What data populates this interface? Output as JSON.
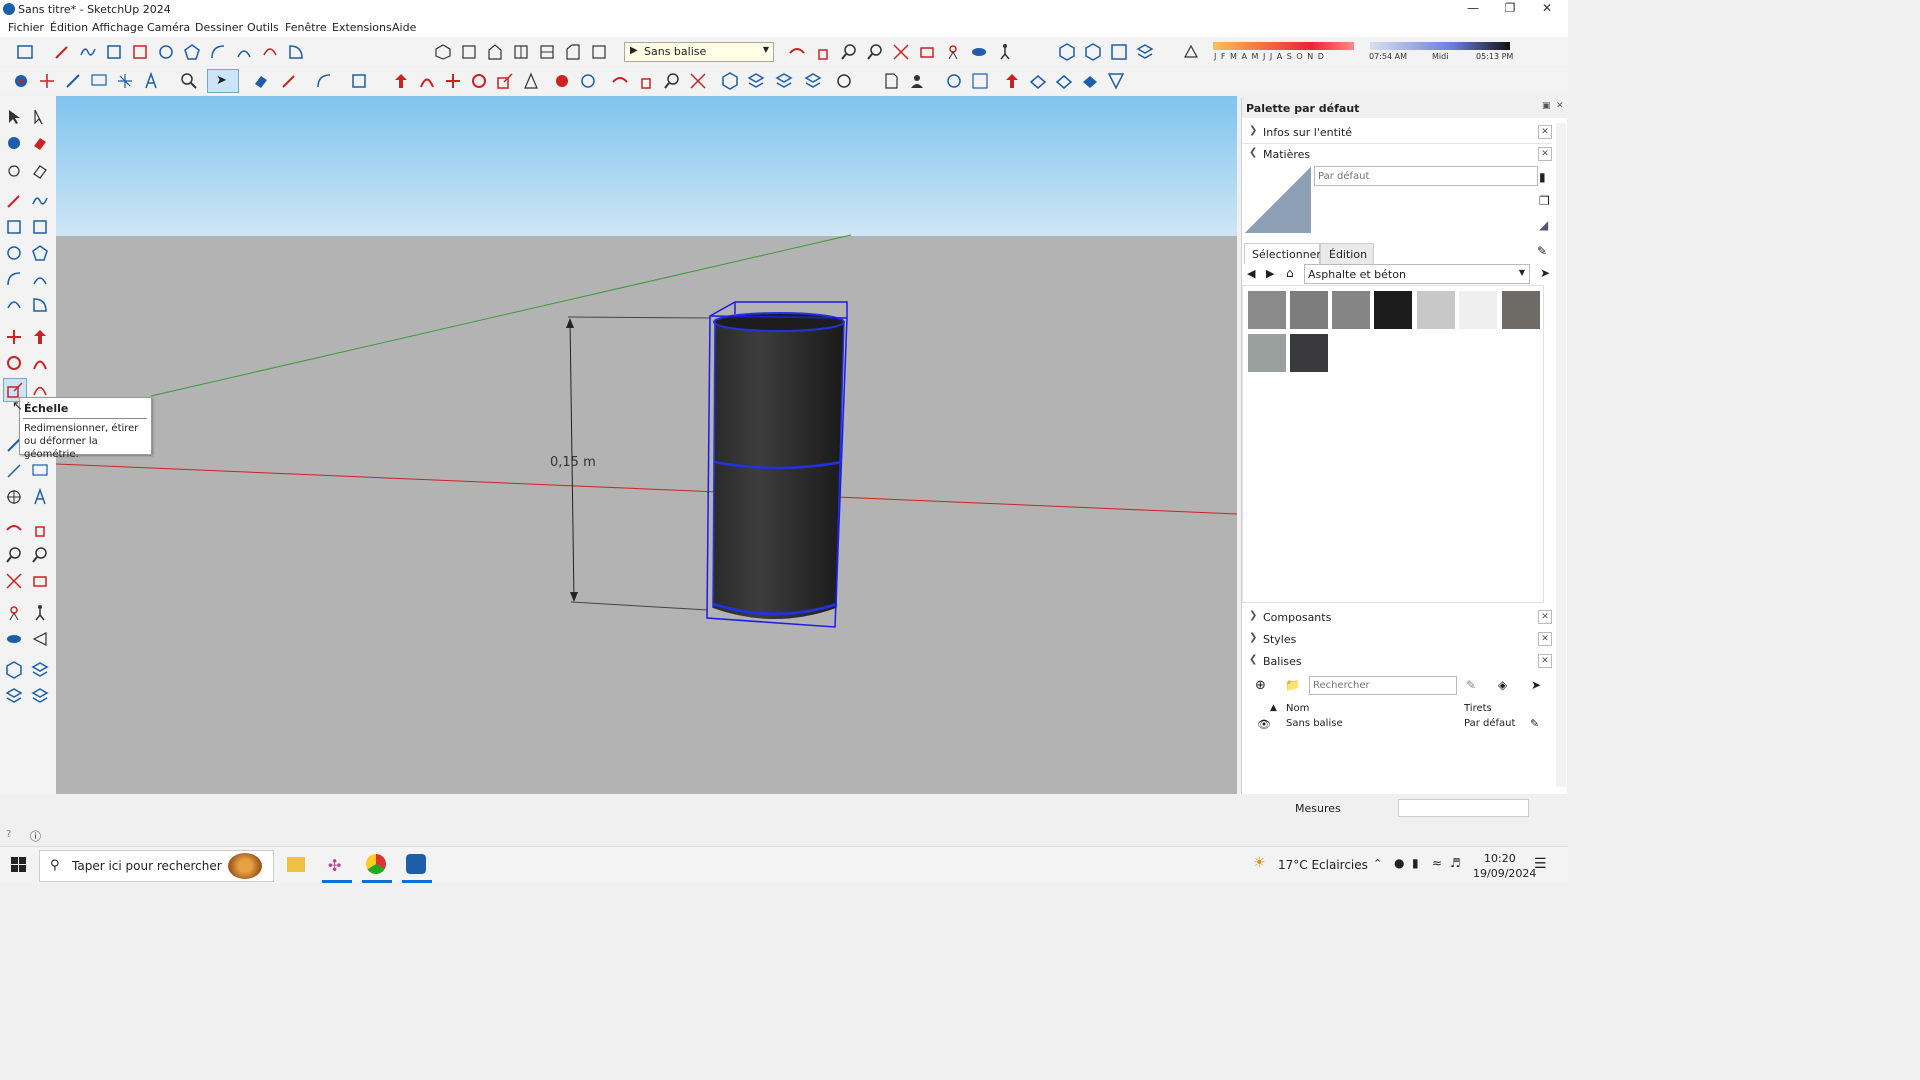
{
  "window": {
    "title": "Sans titre* - SketchUp 2024"
  },
  "menu": [
    "Fichier",
    "Édition",
    "Affichage",
    "Caméra",
    "Dessiner",
    "Outils",
    "Fenêtre",
    "Extensions",
    "Aide"
  ],
  "toolbar": {
    "tag_select": "Sans balise",
    "months": "J F M A M J J A S O N D",
    "time_start": "07:54 AM",
    "time_mid": "Midi",
    "time_end": "05:13 PM"
  },
  "tooltip": {
    "title": "Échelle",
    "description": "Redimensionner, étirer ou déformer la géométrie."
  },
  "viewport": {
    "dimension_label": "0,15 m"
  },
  "tray": {
    "title": "Palette par défaut",
    "entity_info": "Infos sur l'entité",
    "materials": "Matières",
    "material_name_placeholder": "Par défaut",
    "tab_select": "Sélectionner",
    "tab_edit": "Édition",
    "library": "Asphalte et béton",
    "components": "Composants",
    "styles": "Styles",
    "tags": "Balises",
    "tags_search_placeholder": "Rechercher",
    "tags_col_name": "Nom",
    "tags_col_dashes": "Tirets",
    "tag_row_name": "Sans balise",
    "tag_row_dashes": "Par défaut"
  },
  "swatches": [
    "#8a8a8a",
    "#7d7d7d",
    "#858585",
    "#1c1c1c",
    "#c8c8c8",
    "#efefef",
    "#6e6a66",
    "#9aa09e",
    "#3a3a3c"
  ],
  "status": {
    "measurements_label": "Mesures"
  },
  "taskbar": {
    "search_placeholder": "Taper ici pour rechercher",
    "weather": "17°C  Eclaircies",
    "time": "10:20",
    "date": "19/09/2024"
  }
}
